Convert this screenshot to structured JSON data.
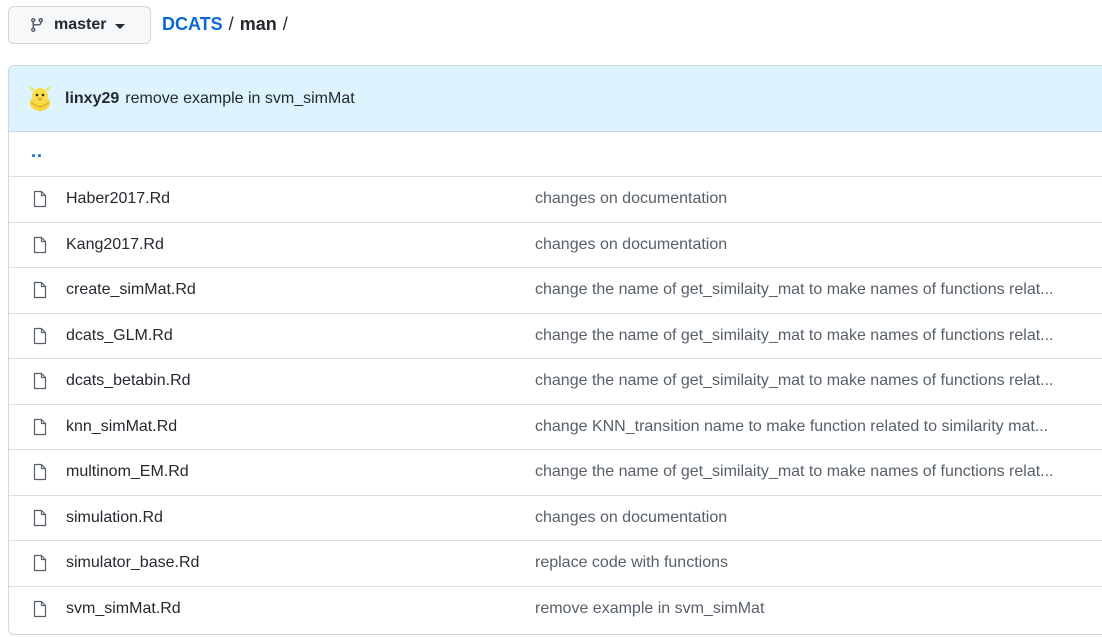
{
  "branch": {
    "name": "master",
    "icon": "git-branch-icon"
  },
  "breadcrumb": {
    "repo": "DCATS",
    "sep1": "/",
    "dir": "man",
    "sep2": "/"
  },
  "commit": {
    "avatar": "avatar-icon",
    "author": "linxy29",
    "message": "remove example in svm_simMat"
  },
  "parent_dir": "..",
  "files": [
    {
      "name": "Haber2017.Rd",
      "message": "changes on documentation"
    },
    {
      "name": "Kang2017.Rd",
      "message": "changes on documentation"
    },
    {
      "name": "create_simMat.Rd",
      "message": "change the name of get_similaity_mat to make names of functions relat..."
    },
    {
      "name": "dcats_GLM.Rd",
      "message": "change the name of get_similaity_mat to make names of functions relat..."
    },
    {
      "name": "dcats_betabin.Rd",
      "message": "change the name of get_similaity_mat to make names of functions relat..."
    },
    {
      "name": "knn_simMat.Rd",
      "message": "change KNN_transition name to make function related to similarity mat..."
    },
    {
      "name": "multinom_EM.Rd",
      "message": "change the name of get_similaity_mat to make names of functions relat..."
    },
    {
      "name": "simulation.Rd",
      "message": "changes on documentation"
    },
    {
      "name": "simulator_base.Rd",
      "message": "replace code with functions"
    },
    {
      "name": "svm_simMat.Rd",
      "message": "remove example in svm_simMat"
    }
  ],
  "colors": {
    "link": "#0969da",
    "commit_bar_bg": "#ddf4ff",
    "border": "#d0d7de"
  }
}
